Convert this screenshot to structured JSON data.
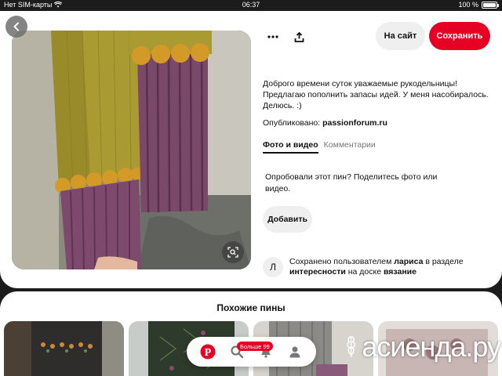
{
  "status_bar": {
    "carrier": "Нет SIM-карты",
    "time": "06:37",
    "battery_percent": "100 %",
    "battery_level": 1.0
  },
  "icons": {
    "back": "chevron-left-icon",
    "more": "more-dots-icon",
    "share": "share-icon",
    "visual_search": "visual-search-icon",
    "home": "pinterest-logo-icon",
    "search": "search-icon",
    "notifications": "bell-icon",
    "profile": "user-icon"
  },
  "colors": {
    "accent": "#e60023",
    "button_bg": "#efefef"
  },
  "actions": {
    "site_label": "На сайт",
    "save_label": "Сохранить"
  },
  "pin": {
    "description": "Доброго времени суток уважаемые рукодельницы! Предлагаю пополнить запасы идей. У меня насобиралось. Делюсь. :)",
    "published_prefix": "Опубликовано: ",
    "published_source": "passionforum.ru"
  },
  "tabs": [
    {
      "label": "Фото и видео",
      "active": true
    },
    {
      "label": "Комментарии",
      "active": false
    }
  ],
  "try_prompt": {
    "text": "Опробовали этот пин? Поделитесь фото или видео.",
    "add_label": "Добавить"
  },
  "saved_by": {
    "avatar_letter": "Л",
    "prefix": "Сохранено пользователем ",
    "user": "лариса",
    "mid1": " в разделе ",
    "section": "интересности",
    "mid2": " на доске ",
    "board": "вязание"
  },
  "similar": {
    "title": "Похожие пины",
    "count": 4
  },
  "bottom_nav": {
    "badge": "Больше 99"
  },
  "watermark": {
    "text": "асиенда.ру"
  }
}
